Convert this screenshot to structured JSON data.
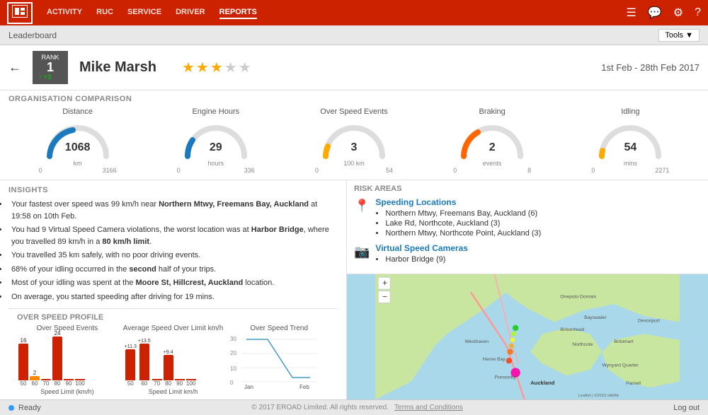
{
  "topnav": {
    "logo": "E",
    "links": [
      "ACTIVITY",
      "RUC",
      "SERVICE",
      "DRIVER",
      "REPORTS"
    ],
    "active_link": "REPORTS",
    "icons": [
      "list-icon",
      "message-icon",
      "gear-icon",
      "help-icon"
    ]
  },
  "leaderboard": {
    "title": "Leaderboard",
    "tools_label": "Tools ▼"
  },
  "header": {
    "rank_label": "RANK",
    "rank_num": "1",
    "rank_change": "+3",
    "driver_name": "Mike Marsh",
    "stars_filled": 3,
    "stars_total": 5,
    "date_range": "1st Feb - 28th Feb 2017"
  },
  "organisation_comparison": {
    "title": "ORGANISATION COMPARISON",
    "gauges": [
      {
        "label": "Distance",
        "value": "1068",
        "unit": "km",
        "min": "0",
        "max": "3166",
        "color": "#1a7abd",
        "percent": 34
      },
      {
        "label": "Engine Hours",
        "value": "29",
        "unit": "hours",
        "min": "0",
        "max": "336",
        "color": "#1a7abd",
        "percent": 9
      },
      {
        "label": "Over Speed Events",
        "value": "3",
        "unit": "100 km",
        "min": "0",
        "max": "54",
        "color": "#ffaa00",
        "percent": 6
      },
      {
        "label": "Braking",
        "value": "2",
        "unit": "events",
        "min": "0",
        "max": "8",
        "color": "#ff6600",
        "percent": 25
      },
      {
        "label": "Idling",
        "value": "54",
        "unit": "mins",
        "min": "0",
        "max": "2271",
        "color": "#ffaa00",
        "percent": 2
      }
    ]
  },
  "insights": {
    "title": "INSIGHTS",
    "bullets": [
      "Your fastest over speed was 99 km/h near <strong>Northern Mtwy, Freemans Bay, Auckland</strong> at 19:58 on 10th Feb.",
      "You had 9 Virtual Speed Camera violations, the worst location was at <strong>Harbor Bridge</strong>, where you travelled 89 km/h in a 80 km/h limit.",
      "You travelled 35 km safely, with no poor driving events.",
      "68% of your idling occurred in the <strong>second</strong> half of your trips.",
      "Most of your idling was spent at the <strong>Moore St, Hillcrest, Auckland</strong> location.",
      "On average, you started speeding after driving for 19 mins."
    ]
  },
  "overspeed_profile": {
    "title": "OVER SPEED PROFILE",
    "charts": [
      {
        "subtitle": "Over Speed Events",
        "bars": [
          {
            "value": 16,
            "label": "50",
            "color": "red",
            "top_label": "16"
          },
          {
            "value": 2,
            "label": "60",
            "color": "orange",
            "top_label": "2"
          },
          {
            "value": 0,
            "label": "70",
            "color": "red",
            "top_label": ""
          },
          {
            "value": 24,
            "label": "80",
            "color": "red",
            "top_label": "24"
          },
          {
            "value": 0,
            "label": "90",
            "color": "red",
            "top_label": ""
          },
          {
            "value": 0,
            "label": "100",
            "color": "red",
            "top_label": ""
          }
        ],
        "x_label": "Speed Limit (km/h)"
      },
      {
        "subtitle": "Average Speed Over Limit km/h",
        "bars": [
          {
            "value": 11.3,
            "label": "50",
            "color": "red",
            "top_label": "+11.3"
          },
          {
            "value": 13.5,
            "label": "60",
            "color": "red",
            "top_label": "+13.5"
          },
          {
            "value": 0,
            "label": "70",
            "color": "red",
            "top_label": ""
          },
          {
            "value": 9.4,
            "label": "80",
            "color": "red",
            "top_label": "+9.4"
          },
          {
            "value": 0,
            "label": "90",
            "color": "red",
            "top_label": ""
          },
          {
            "value": 0,
            "label": "100",
            "color": "red",
            "top_label": ""
          }
        ],
        "x_label": "Speed Limit km/h"
      }
    ],
    "trend_chart": {
      "subtitle": "Over Speed Trend",
      "labels": [
        "Jan",
        "Feb"
      ],
      "values": [
        30,
        5
      ],
      "max_y": 30
    }
  },
  "risk_areas": {
    "title": "RISK AREAS",
    "speeding_locations": {
      "heading": "Speeding Locations",
      "locations": [
        "Northern Mtwy, Freemans Bay, Auckland (6)",
        "Lake Rd, Northcote, Auckland (3)",
        "Northern Mtwy, Northcote Point, Auckland (3)"
      ]
    },
    "virtual_cameras": {
      "heading": "Virtual Speed Cameras",
      "locations": [
        "Harbor Bridge (9)"
      ]
    }
  },
  "footer": {
    "ready_label": "Ready",
    "copyright": "© 2017 EROAD Limited. All rights reserved.",
    "terms": "Terms and Conditions",
    "logout": "Log out"
  }
}
